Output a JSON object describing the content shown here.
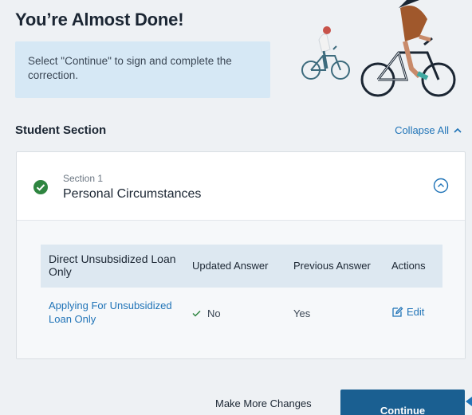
{
  "page": {
    "title": "You’re Almost Done!",
    "instruction": "Select \"Continue\" to sign and complete the correction."
  },
  "student_section": {
    "title": "Student Section",
    "collapse_all_label": "Collapse All"
  },
  "section": {
    "number_label": "Section 1",
    "name": "Personal Circumstances",
    "status": "complete"
  },
  "table": {
    "headers": [
      "Direct Unsubsidized Loan Only",
      "Updated Answer",
      "Previous Answer",
      "Actions"
    ],
    "rows": [
      {
        "question": "Applying For Unsubsidized Loan Only",
        "updated": "No",
        "previous": "Yes",
        "action": "Edit"
      }
    ]
  },
  "footer": {
    "make_more_changes_label": "Make More Changes",
    "continue_label": "Continue"
  },
  "colors": {
    "accent": "#1f73b7",
    "primary_button": "#1a5f91",
    "success": "#2e8540",
    "info_box": "#d6e8f5"
  }
}
